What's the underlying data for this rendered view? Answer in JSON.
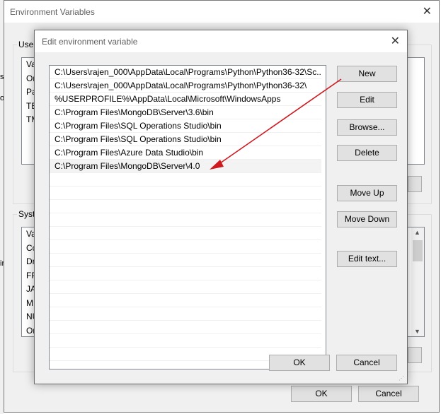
{
  "background_window": {
    "left_strip_fragments": [
      "s",
      "o",
      "",
      "",
      "ir"
    ]
  },
  "env_dialog": {
    "title": "Environment Variables",
    "user_group_label": "User",
    "user_list_header": "Va",
    "user_rows": [
      "On",
      "Pa",
      "TE",
      "TM"
    ],
    "system_group_label": "Syste",
    "system_list_header": "Va",
    "system_rows": [
      "Co",
      "Dr",
      "FP",
      "JA",
      "M",
      "NU",
      "Or"
    ],
    "ok_label": "OK",
    "cancel_label": "Cancel"
  },
  "edit_dialog": {
    "title": "Edit environment variable",
    "paths": [
      "C:\\Users\\rajen_000\\AppData\\Local\\Programs\\Python\\Python36-32\\Sc...",
      "C:\\Users\\rajen_000\\AppData\\Local\\Programs\\Python\\Python36-32\\",
      "%USERPROFILE%\\AppData\\Local\\Microsoft\\WindowsApps",
      "C:\\Program Files\\MongoDB\\Server\\3.6\\bin",
      "C:\\Program Files\\SQL Operations Studio\\bin",
      "C:\\Program Files\\SQL Operations Studio\\bin",
      "C:\\Program Files\\Azure Data Studio\\bin",
      "C:\\Program Files\\MongoDB\\Server\\4.0"
    ],
    "selected_index": 7,
    "buttons": {
      "new": "New",
      "edit": "Edit",
      "browse": "Browse...",
      "delete": "Delete",
      "move_up": "Move Up",
      "move_down": "Move Down",
      "edit_text": "Edit text..."
    },
    "ok_label": "OK",
    "cancel_label": "Cancel"
  },
  "annotation": {
    "arrow_color": "#d0191f"
  }
}
